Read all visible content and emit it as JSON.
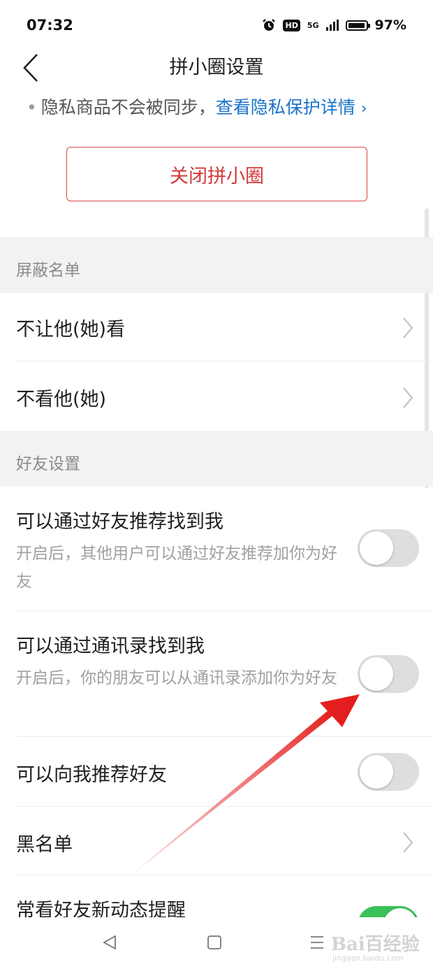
{
  "status_bar": {
    "time": "07:32",
    "alarm_icon": "alarm-clock-icon",
    "hd_label": "HD",
    "network_label": "5G",
    "battery_percent": "97%",
    "battery_level": 0.97
  },
  "header": {
    "back_icon": "chevron-left-icon",
    "title": "拼小圈设置"
  },
  "privacy": {
    "bullet": "•",
    "note": "隐私商品不会被同步，",
    "link_label": "查看隐私保护详情",
    "link_chevron": "›"
  },
  "close_button": {
    "label": "关闭拼小圈",
    "color": "#d33a3a"
  },
  "sections": {
    "block_list": {
      "header": "屏蔽名单",
      "items": [
        {
          "label": "不让他(她)看"
        },
        {
          "label": "不看他(她)"
        }
      ]
    },
    "friend_settings": {
      "header": "好友设置",
      "items": [
        {
          "label": "可以通过好友推荐找到我",
          "desc": "开启后，其他用户可以通过好友推荐加你为好友",
          "toggle_on": false
        },
        {
          "label": "可以通过通讯录找到我",
          "desc": "开启后，你的朋友可以从通讯录添加你为好友",
          "toggle_on": false
        },
        {
          "label": "可以向我推荐好友",
          "toggle_on": false
        },
        {
          "label": "黑名单"
        },
        {
          "label": "常看好友新动态提醒",
          "toggle_on": true
        }
      ]
    }
  },
  "colors": {
    "accent_link": "#1a73c8",
    "toggle_on": "#3cc05a",
    "toggle_off": "#dedede",
    "annotation_arrow": "#e41e1e"
  },
  "bottom_nav": {
    "back_icon": "triangle-back-icon",
    "home_icon": "square-home-icon",
    "menu_icon": "menu-lines-icon"
  },
  "watermark": {
    "text": "Bai百经验",
    "sub": "jingyan.baidu.com"
  }
}
